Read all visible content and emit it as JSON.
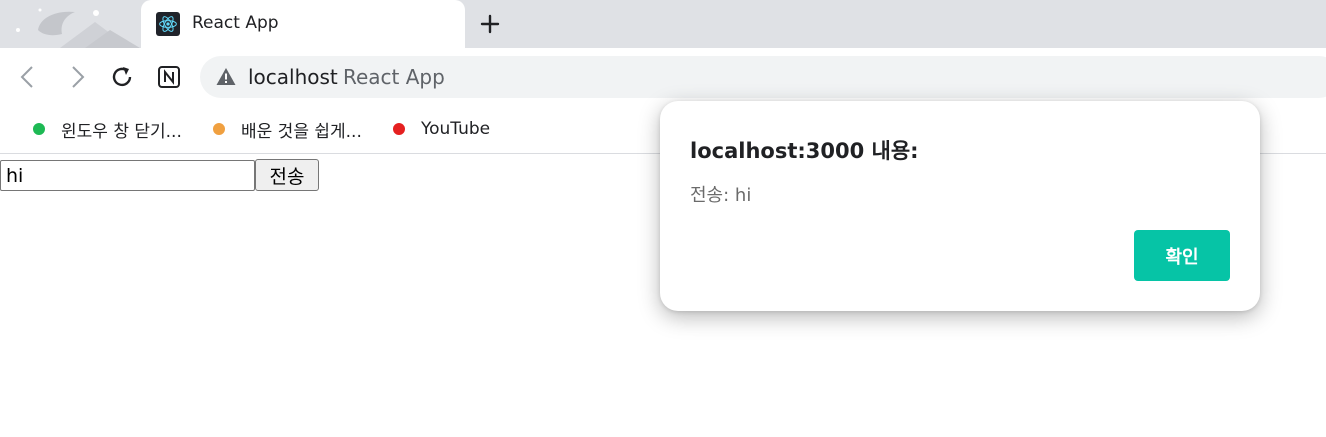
{
  "browser": {
    "tab": {
      "title": "React App",
      "favicon": "react-logo-icon"
    },
    "new_tab_icon": "plus-icon",
    "toolbar": {
      "back_icon": "back-arrow-icon",
      "forward_icon": "forward-arrow-icon",
      "reload_icon": "reload-icon",
      "notion_icon": "notion-icon"
    },
    "omnibox": {
      "security_icon": "warning-icon",
      "host": "localhost",
      "page_title": "React App"
    },
    "bookmarks": [
      {
        "label": "윈도우 창 닫기...",
        "color": "#1db954"
      },
      {
        "label": "배운 것을 쉽게...",
        "color": "#f0a040"
      },
      {
        "label": "YouTube",
        "color": "#e52020"
      }
    ]
  },
  "page": {
    "message_input_value": "hi",
    "send_button_label": "전송"
  },
  "dialog": {
    "title": "localhost:3000 내용:",
    "message": "전송: hi",
    "ok_label": "확인",
    "ok_color": "#06c4a6"
  }
}
